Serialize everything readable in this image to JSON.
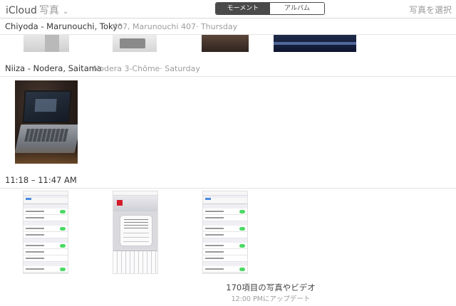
{
  "app": {
    "brand": "iCloud",
    "section": "写真"
  },
  "view_switch": {
    "moments_label": "モーメント",
    "albums_label": "アルバム",
    "selected": "moments"
  },
  "select_label": "写真を選択",
  "moments": [
    {
      "title": "Chiyoda - Marunouchi, Tokyo",
      "subtitle": "407, Marunouchi 407· Thursday"
    },
    {
      "title": "Niiza - Nodera, Saitama",
      "subtitle": "Nodera 3-Chōme· Saturday"
    },
    {
      "title": "11:18 – 11:47 AM",
      "subtitle": ""
    }
  ],
  "footer": {
    "count_text": "170項目の写真やビデオ",
    "updated_text": "12:00 PMにアップデート"
  }
}
